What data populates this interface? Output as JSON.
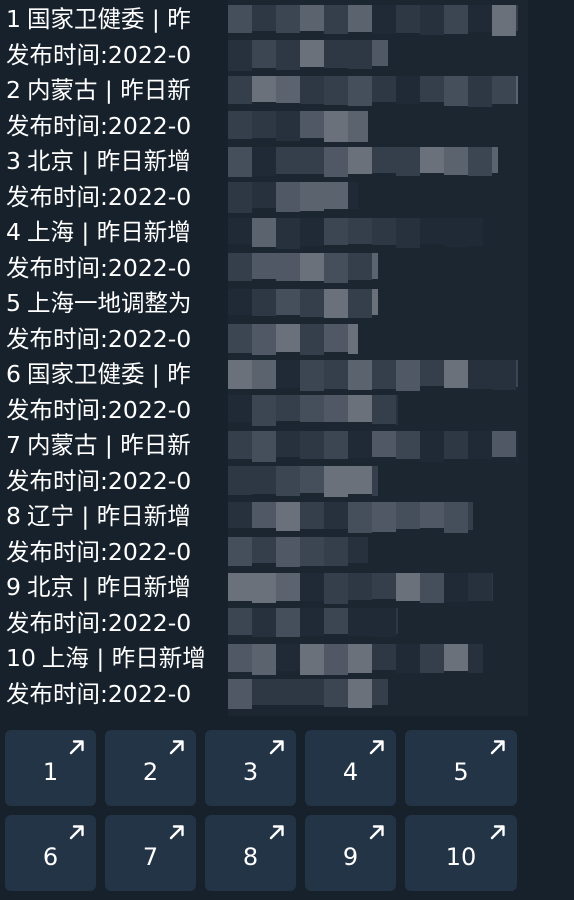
{
  "colors": {
    "background": "#17212b",
    "button_bg": "#243447",
    "text": "#ffffff"
  },
  "news": [
    {
      "no": "1",
      "title": "国家卫健委 | 昨",
      "time": "发布时间:2022-0"
    },
    {
      "no": "2",
      "title": "内蒙古 | 昨日新",
      "time": "发布时间:2022-0"
    },
    {
      "no": "3",
      "title": "北京 | 昨日新增",
      "time": "发布时间:2022-0"
    },
    {
      "no": "4",
      "title": "上海 | 昨日新增",
      "time": "发布时间:2022-0"
    },
    {
      "no": "5",
      "title": "上海一地调整为",
      "time": "发布时间:2022-0"
    },
    {
      "no": "6",
      "title": "国家卫健委 | 昨",
      "time": "发布时间:2022-0"
    },
    {
      "no": "7",
      "title": "内蒙古 | 昨日新",
      "time": "发布时间:2022-0"
    },
    {
      "no": "8",
      "title": "辽宁 | 昨日新增",
      "time": "发布时间:2022-0"
    },
    {
      "no": "9",
      "title": "北京 | 昨日新增",
      "time": "发布时间:2022-0"
    },
    {
      "no": "10",
      "title": "上海 | 昨日新增",
      "time": "发布时间:2022-0"
    }
  ],
  "buttons": {
    "row1": [
      "1",
      "2",
      "3",
      "4",
      "5"
    ],
    "row2": [
      "6",
      "7",
      "8",
      "9",
      "10"
    ],
    "icon": "external-link-arrow-icon"
  }
}
